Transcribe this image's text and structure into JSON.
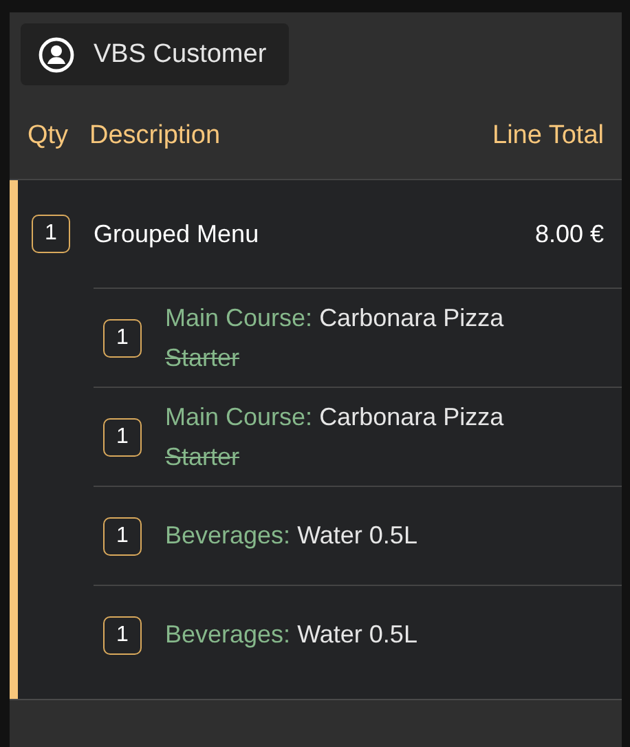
{
  "customer_button": {
    "label": "VBS Customer"
  },
  "table": {
    "columns": [
      "Qty",
      "Description",
      "Line Total"
    ],
    "rows": [
      {
        "qty": "1",
        "description": "Grouped Menu",
        "line_total": "8.00 €",
        "selected": true,
        "children": [
          {
            "qty": "1",
            "category": "Main Course:",
            "name": "Carbonara Pizza",
            "modifiers": [
              {
                "text": "Starter",
                "removed": true
              }
            ]
          },
          {
            "qty": "1",
            "category": "Main Course:",
            "name": "Carbonara Pizza",
            "modifiers": [
              {
                "text": "Starter",
                "removed": true
              }
            ]
          },
          {
            "qty": "1",
            "category": "Beverages:",
            "name": "Water 0.5L"
          },
          {
            "qty": "1",
            "category": "Beverages:",
            "name": "Water 0.5L"
          }
        ]
      }
    ]
  }
}
